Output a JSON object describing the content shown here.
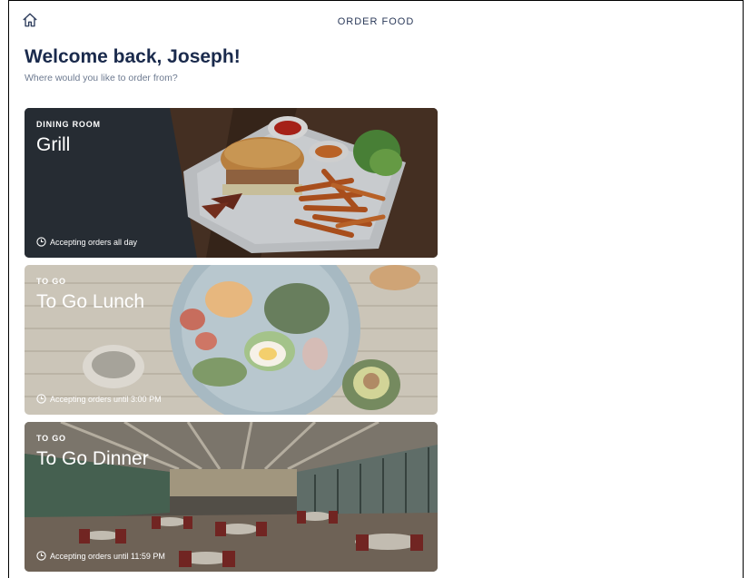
{
  "header": {
    "title": "ORDER FOOD",
    "home_icon": "home-icon"
  },
  "welcome": {
    "heading": "Welcome back, Joseph!",
    "subtitle": "Where would you like to order from?"
  },
  "venues": [
    {
      "tag": "DINING ROOM",
      "name": "Grill",
      "status": "Accepting orders all day",
      "image": "burger-and-fries-plate"
    },
    {
      "tag": "TO GO",
      "name": "To Go Lunch",
      "status": "Accepting orders until 3:00 PM",
      "image": "salad-bowl"
    },
    {
      "tag": "TO GO",
      "name": "To Go Dinner",
      "status": "Accepting orders until 11:59 PM",
      "image": "cafeteria-dining-hall"
    }
  ],
  "colors": {
    "heading": "#1a2a4c",
    "subtitle": "#6d7a90"
  }
}
